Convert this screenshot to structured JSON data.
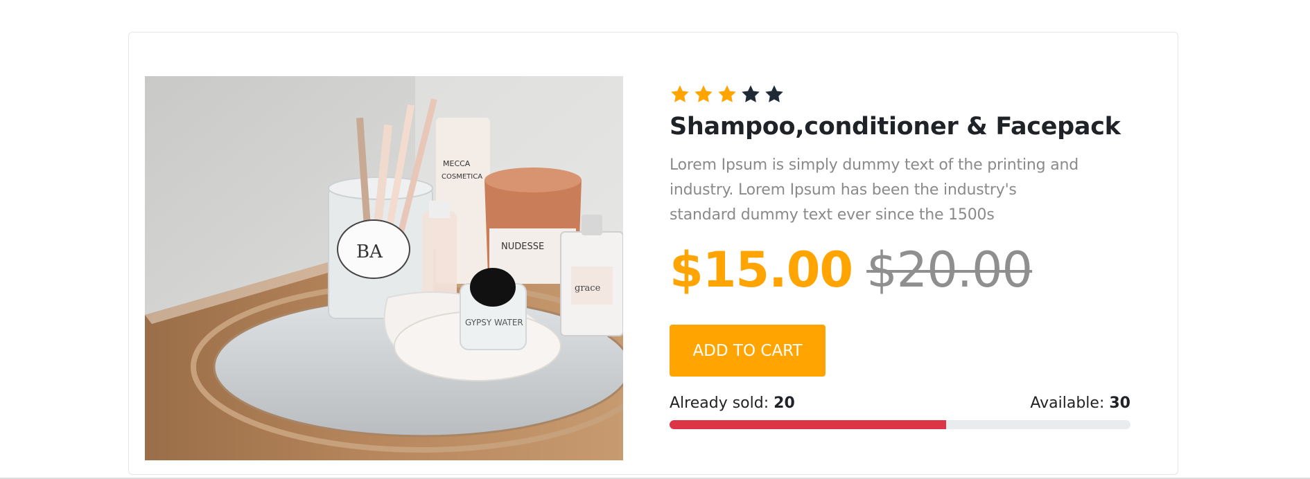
{
  "product": {
    "rating": 3,
    "rating_max": 5,
    "title": "Shampoo,conditioner & Facepack",
    "description": "Lorem Ipsum is simply dummy text of the printing and industry. Lorem Ipsum has been the industry's standard dummy text ever since the 1500s",
    "price": "$15.00",
    "old_price": "$20.00",
    "add_to_cart_label": "ADD TO CART",
    "sold_label": "Already sold:",
    "sold_value": "20",
    "available_label": "Available:",
    "available_value": "30",
    "stock_progress_fraction": 0.6
  },
  "colors": {
    "accent": "#ffa400",
    "star_empty": "#1f2a36",
    "progress_fill": "#dc3545",
    "progress_track": "#e9ecef"
  },
  "icons": {
    "star": "star-icon"
  }
}
